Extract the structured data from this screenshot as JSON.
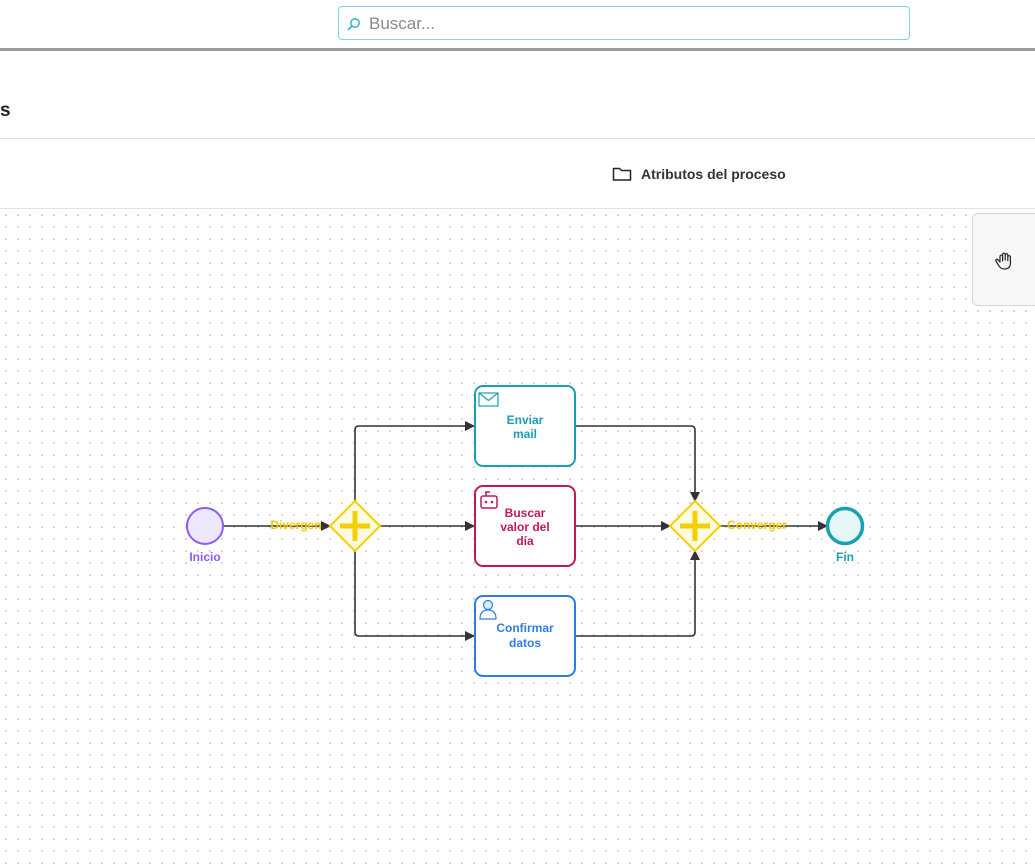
{
  "header": {
    "search_placeholder": "Buscar..."
  },
  "page": {
    "title": "s",
    "attributes_label": "Atributos del proceso"
  },
  "diagram": {
    "start_event": {
      "label": "Inicio",
      "color": "#8b5cf6"
    },
    "diverge_gateway": {
      "label": "Divergen",
      "color": "#f5d000"
    },
    "converge_gateway": {
      "label": "Converger",
      "color": "#f5d000"
    },
    "end_event": {
      "label": "Fin",
      "color": "#1b9fb3"
    },
    "tasks": [
      {
        "line1": "Enviar",
        "line2": "mail",
        "line3": "",
        "icon": "mail-icon",
        "color": "#1b9fb3"
      },
      {
        "line1": "Buscar",
        "line2": "valor del",
        "line3": "día",
        "icon": "robot-icon",
        "color": "#c2185b"
      },
      {
        "line1": "Confirmar",
        "line2": "datos",
        "line3": "",
        "icon": "user-icon",
        "color": "#2f7de1"
      }
    ]
  },
  "tools": {
    "hand_icon": "hand-icon"
  }
}
